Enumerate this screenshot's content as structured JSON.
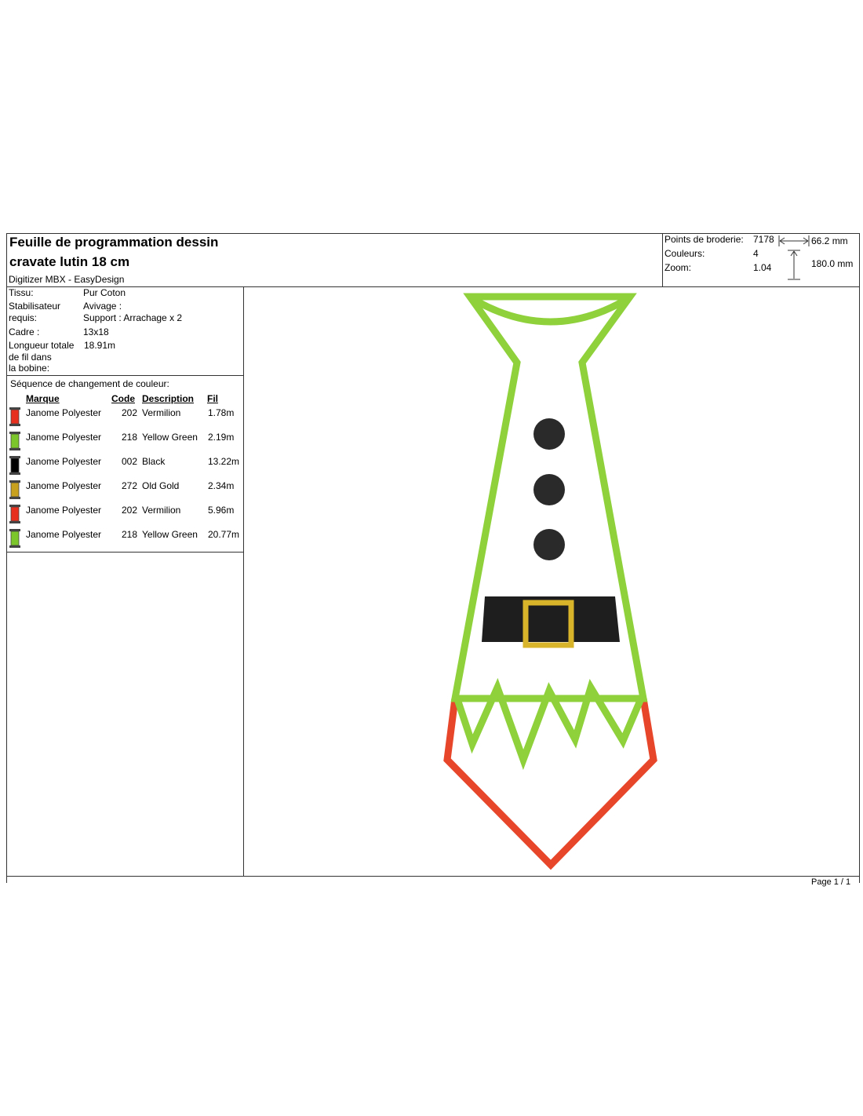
{
  "header": {
    "title_line1": "Feuille de programmation dessin",
    "title_line2": "cravate lutin 18 cm",
    "software": "Digitizer MBX - EasyDesign"
  },
  "stats": {
    "stitches_label": "Points de broderie:",
    "stitches_value": "7178",
    "colors_label": "Couleurs:",
    "colors_value": "4",
    "zoom_label": "Zoom:",
    "zoom_value": "1.04",
    "width": "66.2 mm",
    "height": "180.0 mm"
  },
  "details": {
    "fabric_label": "Tissu:",
    "fabric_value": "Pur Coton",
    "stabilizer_label_1": "Stabilisateur",
    "stabilizer_label_2": "requis:",
    "stabilizer_value_1": "Avivage :",
    "stabilizer_value_2": "Support : Arrachage x 2",
    "hoop_label": "Cadre :",
    "hoop_value": "13x18",
    "thread_label_1": "Longueur totale",
    "thread_label_2": "de fil dans",
    "thread_label_3": "la bobine:",
    "thread_value": "18.91m"
  },
  "sequence": {
    "title": "Séquence de changement de couleur:",
    "col_brand": "Marque",
    "col_code": "Code",
    "col_desc": "Description",
    "col_thread": "Fil",
    "rows": [
      {
        "brand": "Janome Polyester",
        "code": "202",
        "desc": "Vermilion",
        "thread": "1.78m",
        "color": "#e8301e"
      },
      {
        "brand": "Janome Polyester",
        "code": "218",
        "desc": "Yellow Green",
        "thread": "2.19m",
        "color": "#7cc52a"
      },
      {
        "brand": "Janome Polyester",
        "code": "002",
        "desc": "Black",
        "thread": "13.22m",
        "color": "#000000"
      },
      {
        "brand": "Janome Polyester",
        "code": "272",
        "desc": "Old Gold",
        "thread": "2.34m",
        "color": "#c8a21e"
      },
      {
        "brand": "Janome Polyester",
        "code": "202",
        "desc": "Vermilion",
        "thread": "5.96m",
        "color": "#e8301e"
      },
      {
        "brand": "Janome Polyester",
        "code": "218",
        "desc": "Yellow Green",
        "thread": "20.77m",
        "color": "#7cc52a"
      }
    ]
  },
  "footer": {
    "page": "Page 1 / 1"
  },
  "colors": {
    "green": "#8ed13a",
    "red": "#e8462a",
    "black": "#1e1e1e",
    "gold": "#d8b42a"
  }
}
